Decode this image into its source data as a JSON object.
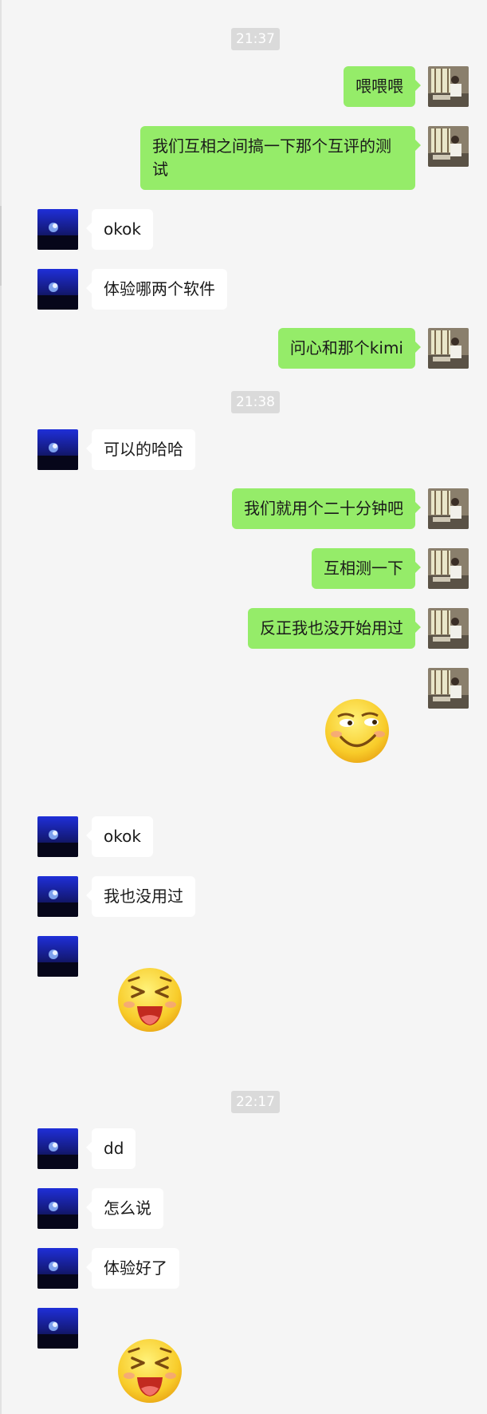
{
  "chat": {
    "messages": [
      {
        "type": "time",
        "text": "21:37"
      },
      {
        "type": "text",
        "side": "me",
        "text": "喂喂喂"
      },
      {
        "type": "text",
        "side": "me",
        "text": "我们互相之间搞一下那个互评的测试"
      },
      {
        "type": "text",
        "side": "other",
        "text": "okok"
      },
      {
        "type": "text",
        "side": "other",
        "text": "体验哪两个软件"
      },
      {
        "type": "text",
        "side": "me",
        "text": "问心和那个kimi"
      },
      {
        "type": "time",
        "text": "21:38"
      },
      {
        "type": "text",
        "side": "other",
        "text": "可以的哈哈"
      },
      {
        "type": "text",
        "side": "me",
        "text": "我们就用个二十分钟吧"
      },
      {
        "type": "text",
        "side": "me",
        "text": "互相测一下"
      },
      {
        "type": "text",
        "side": "me",
        "text": "反正我也没开始用过"
      },
      {
        "type": "sticker",
        "side": "me",
        "emoji": "smirk-emoji"
      },
      {
        "type": "text",
        "side": "other",
        "text": "okok"
      },
      {
        "type": "text",
        "side": "other",
        "text": "我也没用过"
      },
      {
        "type": "sticker",
        "side": "other",
        "emoji": "laughing-emoji"
      },
      {
        "type": "time",
        "text": "22:17"
      },
      {
        "type": "text",
        "side": "other",
        "text": "dd"
      },
      {
        "type": "text",
        "side": "other",
        "text": "怎么说"
      },
      {
        "type": "text",
        "side": "other",
        "text": "体验好了"
      },
      {
        "type": "sticker",
        "side": "other",
        "emoji": "laughing-emoji"
      }
    ]
  },
  "colors": {
    "background": "#f5f5f5",
    "my_bubble": "#95ec69",
    "their_bubble": "#ffffff",
    "timestamp_bg": "#dadada"
  }
}
